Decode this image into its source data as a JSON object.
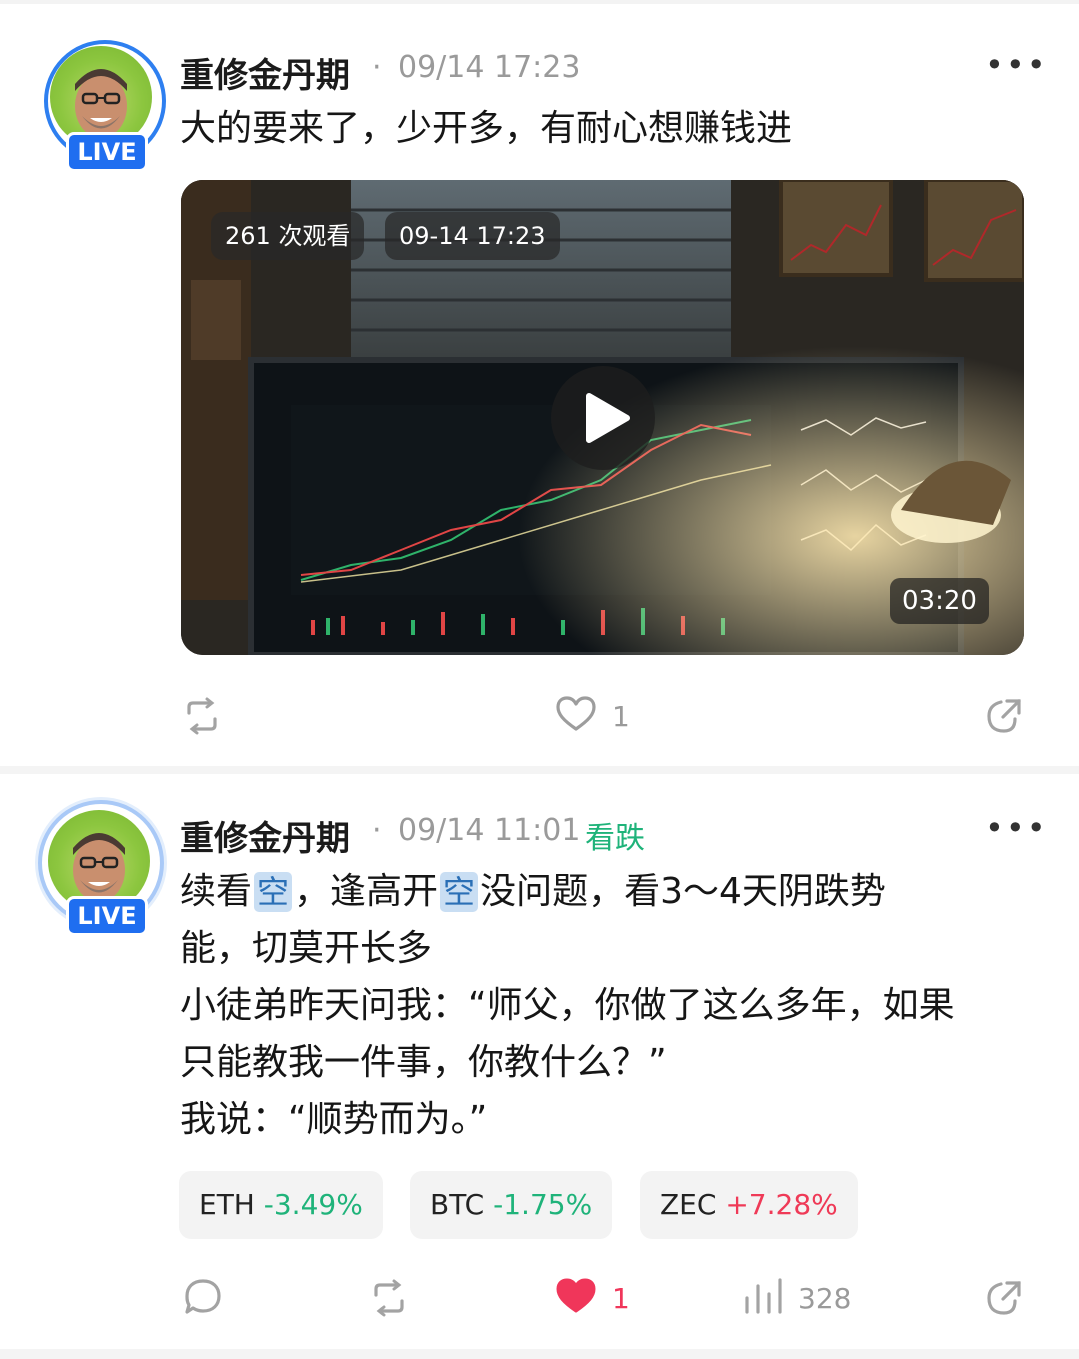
{
  "posts": [
    {
      "author": "重修金丹期",
      "time": "09/14 17:23",
      "text": "大的要来了，少开多，有耐心想赚钱进",
      "live_label": "LIVE",
      "video": {
        "views": "261 次观看",
        "date": "09-14 17:23",
        "duration": "03:20"
      },
      "likes": "1"
    },
    {
      "author": "重修金丹期",
      "time": "09/14 11:01",
      "tag": "看跌",
      "live_label": "LIVE",
      "text_lines": [
        "续看",
        "空",
        "，逢高开",
        "空",
        "没问题，看3～4天阴跌势",
        "能，切莫开长多",
        "小徒弟昨天问我：“师父，你做了这么多年，如果",
        "只能教我一件事，你教什么？”",
        "我说：“顺势而为。”"
      ],
      "tickers": [
        {
          "symbol": "ETH",
          "change": "-3.49%",
          "direction": "down"
        },
        {
          "symbol": "BTC",
          "change": "-1.75%",
          "direction": "down"
        },
        {
          "symbol": "ZEC",
          "change": "+7.28%",
          "direction": "up"
        }
      ],
      "likes": "1",
      "views": "328"
    }
  ],
  "colors": {
    "accent_blue": "#1f6ef0",
    "down_green": "#1fb37a",
    "up_red": "#ef3a57",
    "like_red": "#f0365a"
  }
}
